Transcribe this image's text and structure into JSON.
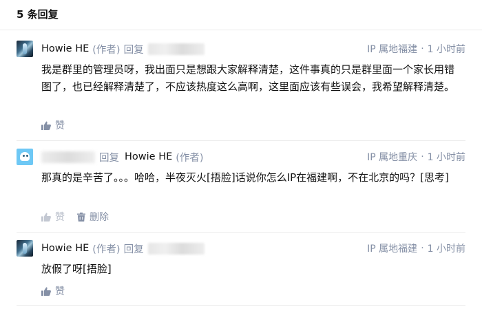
{
  "header": {
    "reply_count": "5 条回复"
  },
  "comments": [
    {
      "name": "Howie HE",
      "author_tag": "(作者)",
      "reply_word": "回复",
      "location": "IP 属地福建",
      "time": "1 小时前",
      "content": "我是群里的管理员呀，我出面只是想跟大家解释清楚，这件事真的只是群里面一个家长用错图了，也已经解释清楚了，不应该热度这么高啊，这里面应该有些误会，我希望解释清楚。",
      "like_label": "赞"
    },
    {
      "reply_word": "回复",
      "target_name": "Howie HE",
      "author_tag": "(作者)",
      "location": "IP 属地重庆",
      "time": "1 小时前",
      "content": "那真的是辛苦了。。。哈哈，半夜灭火[捂脸]话说你怎么IP在福建啊，不在北京的吗？[思考]",
      "like_label": "赞",
      "delete_label": "删除"
    },
    {
      "name": "Howie HE",
      "author_tag": "(作者)",
      "reply_word": "回复",
      "location": "IP 属地福建",
      "time": "1 小时前",
      "content": "放假了呀[捂脸]",
      "like_label": "赞"
    }
  ],
  "separator": "·",
  "icons": {
    "like": "thumbs-up-icon",
    "delete": "trash-icon"
  },
  "colors": {
    "text": "#121212",
    "muted": "#8590a6",
    "divider": "#ebebeb"
  }
}
